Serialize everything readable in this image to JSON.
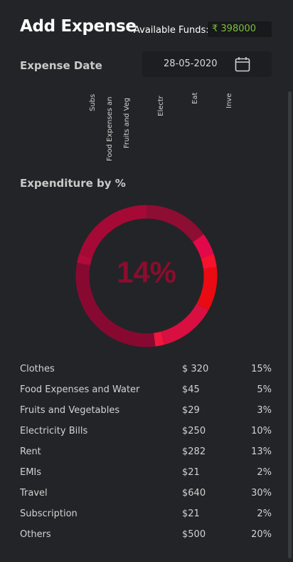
{
  "header": {
    "title": "Add Expense",
    "funds_label": "Available Funds:",
    "funds_value": "₹ 398000"
  },
  "date": {
    "label": "Expense Date",
    "value": "28-05-2020",
    "icon": "calendar-icon"
  },
  "bar_labels": [
    "Subs",
    "Food Expenses an",
    "Fruits and Veg",
    "Electr",
    "Eat",
    "Inve"
  ],
  "section_title": "Expenditure by %",
  "chart_data": {
    "type": "pie",
    "center_label": "14%",
    "categories": [
      "Clothes",
      "Food Expenses and Water",
      "Fruits and Vegetables",
      "Electricity Bills",
      "Rent",
      "EMIs",
      "Travel",
      "Subscription",
      "Others"
    ],
    "values": [
      15,
      5,
      3,
      10,
      13,
      2,
      30,
      2,
      20
    ],
    "colors": [
      "#8e0d33",
      "#e2094a",
      "#f5122d",
      "#ea0a12",
      "#d80f40",
      "#f1173c",
      "#870932",
      "#b10a3a",
      "#a40a35"
    ]
  },
  "table": {
    "rows": [
      {
        "name": "Clothes",
        "amount": "$ 320",
        "pct": "15%"
      },
      {
        "name": "Food Expenses and Water",
        "amount": "$45",
        "pct": "5%"
      },
      {
        "name": "Fruits and Vegetables",
        "amount": "$29",
        "pct": "3%"
      },
      {
        "name": "Electricity Bills",
        "amount": "$250",
        "pct": "10%"
      },
      {
        "name": "Rent",
        "amount": "$282",
        "pct": "13%"
      },
      {
        "name": "EMIs",
        "amount": "$21",
        "pct": "2%"
      },
      {
        "name": "Travel",
        "amount": "$640",
        "pct": "30%"
      },
      {
        "name": "Subscription",
        "amount": "$21",
        "pct": "2%"
      },
      {
        "name": "Others",
        "amount": "$500",
        "pct": "20%"
      }
    ]
  }
}
